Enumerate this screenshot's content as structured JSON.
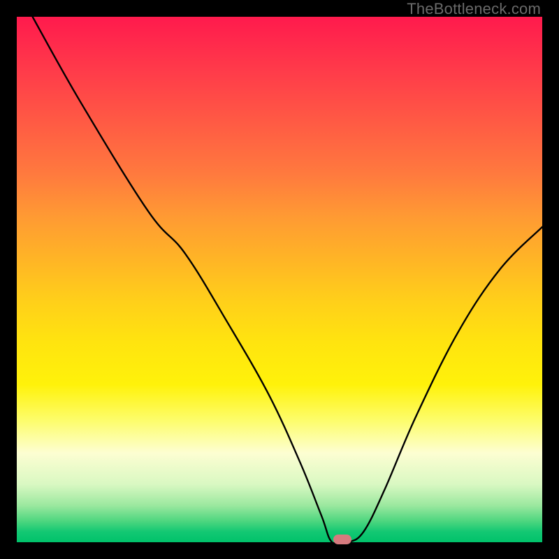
{
  "watermark": "TheBottleneck.com",
  "chart_data": {
    "type": "line",
    "title": "",
    "xlabel": "",
    "ylabel": "",
    "xlim": [
      0,
      100
    ],
    "ylim": [
      0,
      100
    ],
    "grid": false,
    "legend": false,
    "series": [
      {
        "name": "bottleneck-curve",
        "x": [
          3,
          12,
          25,
          32,
          40,
          48,
          54,
          58,
          60,
          63,
          66,
          70,
          76,
          84,
          92,
          100
        ],
        "values": [
          100,
          84,
          63,
          55,
          42,
          28,
          15,
          5,
          0,
          0,
          2,
          10,
          24,
          40,
          52,
          60
        ]
      }
    ],
    "annotations": [
      {
        "name": "optimal-marker",
        "x": 62,
        "y": 0
      }
    ],
    "background_gradient": {
      "top": "#ff1a4d",
      "mid": "#fff20a",
      "bottom": "#00c26a"
    }
  }
}
